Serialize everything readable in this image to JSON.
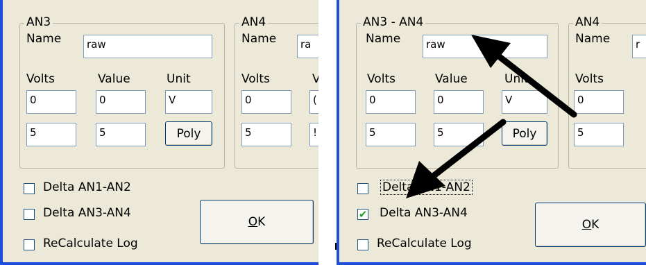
{
  "left": {
    "group_main": {
      "legend": "AN3",
      "name_label": "Name",
      "name_value": "raw",
      "volts_label": "Volts",
      "value_label": "Value",
      "unit_label": "Unit",
      "volts_1": "0",
      "value_1": "0",
      "unit_1": "V",
      "volts_2": "5",
      "value_2": "5",
      "poly_label": "Poly"
    },
    "group_side": {
      "legend": "AN4",
      "name_label": "Name",
      "name_value": "ra",
      "volts_label": "Volts",
      "value_label_partial": "V",
      "volts_1": "0",
      "value_1_partial": "(",
      "volts_2": "5",
      "value_2_partial": "!"
    },
    "checkboxes": [
      {
        "label": "Delta AN1-AN2",
        "checked": false
      },
      {
        "label": "Delta AN3-AN4",
        "checked": false
      },
      {
        "label": "ReCalculate Log",
        "checked": false
      }
    ],
    "ok_button": {
      "mnemonic": "O",
      "rest": "K"
    }
  },
  "right": {
    "group_main": {
      "legend": "AN3 - AN4",
      "name_label": "Name",
      "name_value": "raw",
      "volts_label": "Volts",
      "value_label": "Value",
      "unit_label": "Unit",
      "volts_1": "0",
      "value_1": "0",
      "unit_1": "V",
      "volts_2": "5",
      "value_2": "5",
      "poly_label": "Poly"
    },
    "group_side": {
      "legend": "AN4",
      "name_label": "Name",
      "name_value": "r",
      "volts_label": "Volts",
      "volts_1": "0",
      "volts_2": "5"
    },
    "checkboxes": [
      {
        "label": "Delta AN1-AN2",
        "checked": false
      },
      {
        "label": "Delta AN3-AN4",
        "checked": true
      },
      {
        "label": "ReCalculate Log",
        "checked": false
      }
    ],
    "ok_button": {
      "mnemonic": "O",
      "rest": "K"
    },
    "check_mark": "✔"
  },
  "colors": {
    "dialog_bg": "#ece9d8",
    "window_border": "#1f4fd8",
    "arrow": "#000000",
    "checkmark": "#21a121"
  },
  "icons": [
    "arrow-to-legend-icon",
    "arrow-to-checkbox-icon"
  ]
}
